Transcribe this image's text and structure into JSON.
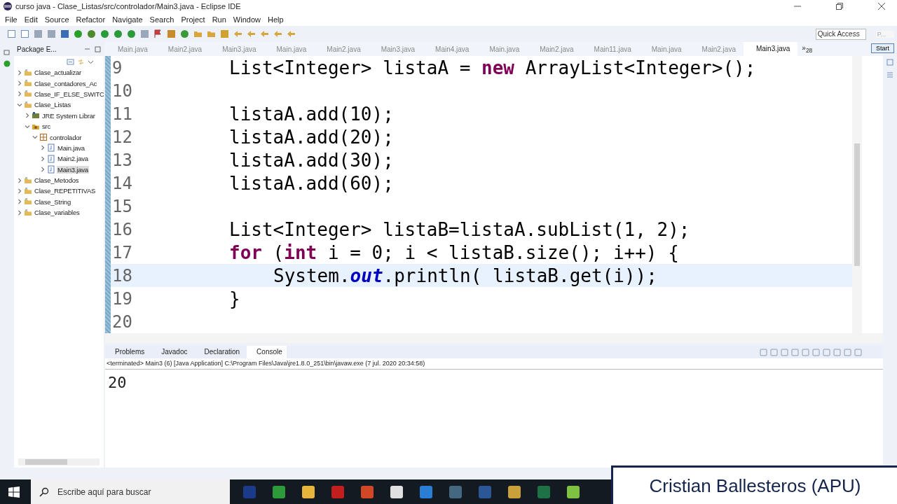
{
  "window": {
    "title": "curso java - Clase_Listas/src/controlador/Main3.java - Eclipse IDE"
  },
  "menu": [
    "File",
    "Edit",
    "Source",
    "Refactor",
    "Navigate",
    "Search",
    "Project",
    "Run",
    "Window",
    "Help"
  ],
  "toolbar": {
    "quick_access": {
      "placeholder": "Quick Access"
    },
    "perspective_label": "P...",
    "start_button": "Start"
  },
  "package_explorer": {
    "title": "Package E...",
    "tree": [
      {
        "label": "Clase_actualizar",
        "kind": "project",
        "expanded": false,
        "selected": false
      },
      {
        "label": "Clase_contadores_Ac",
        "kind": "project",
        "expanded": false,
        "selected": false
      },
      {
        "label": "Clase_IF_ELSE_SWITC",
        "kind": "project",
        "expanded": false,
        "selected": false
      },
      {
        "label": "Clase_Listas",
        "kind": "project",
        "expanded": true,
        "selected": false,
        "children": [
          {
            "label": "JRE System Librar",
            "kind": "library",
            "expanded": false,
            "selected": false
          },
          {
            "label": "src",
            "kind": "source",
            "expanded": true,
            "selected": false,
            "children": [
              {
                "label": "controlador",
                "kind": "package",
                "expanded": true,
                "selected": false,
                "children": [
                  {
                    "label": "Main.java",
                    "kind": "file",
                    "expanded": false,
                    "selected": false
                  },
                  {
                    "label": "Main2.java",
                    "kind": "file",
                    "expanded": false,
                    "selected": false
                  },
                  {
                    "label": "Main3.java",
                    "kind": "file",
                    "expanded": false,
                    "selected": true
                  }
                ]
              }
            ]
          }
        ]
      },
      {
        "label": "Clase_Metodos",
        "kind": "project",
        "expanded": false,
        "selected": false
      },
      {
        "label": "Clase_REPETITIVAS",
        "kind": "project",
        "expanded": false,
        "selected": false
      },
      {
        "label": "Clase_String",
        "kind": "project",
        "expanded": false,
        "selected": false
      },
      {
        "label": "Clase_variables",
        "kind": "project",
        "expanded": false,
        "selected": false
      }
    ]
  },
  "editor": {
    "tabs": [
      {
        "label": "Main.java",
        "selected": false
      },
      {
        "label": "Main2.java",
        "selected": false
      },
      {
        "label": "Main3.java",
        "selected": false
      },
      {
        "label": "Main.java",
        "selected": false
      },
      {
        "label": "Main2.java",
        "selected": false
      },
      {
        "label": "Main3.java",
        "selected": false
      },
      {
        "label": "Main4.java",
        "selected": false
      },
      {
        "label": "Main.java",
        "selected": false
      },
      {
        "label": "Main2.java",
        "selected": false
      },
      {
        "label": "Main11.java",
        "selected": false
      },
      {
        "label": "Main.java",
        "selected": false
      },
      {
        "label": "Main2.java",
        "selected": false
      },
      {
        "label": "Main3.java",
        "selected": true
      }
    ],
    "more_tabs": {
      "label": "»",
      "count": "28"
    },
    "lines": [
      {
        "number": "9",
        "current": false,
        "kind": "statement",
        "tokens": [
          {
            "kind": "plain",
            "text": "List<Integer> listaA = "
          },
          {
            "kind": "keyword",
            "text": "new"
          },
          {
            "kind": "plain",
            "text": " ArrayList<Integer>();"
          }
        ]
      },
      {
        "number": "10",
        "current": false
      },
      {
        "number": "11",
        "current": false,
        "kind": "statement",
        "tokens": [
          {
            "kind": "plain",
            "text": "listaA.add(10);"
          }
        ]
      },
      {
        "number": "12",
        "current": false,
        "kind": "statement",
        "tokens": [
          {
            "kind": "plain",
            "text": "listaA.add(20);"
          }
        ]
      },
      {
        "number": "13",
        "current": false,
        "kind": "statement",
        "tokens": [
          {
            "kind": "plain",
            "text": "listaA.add(30);"
          }
        ]
      },
      {
        "number": "14",
        "current": false,
        "kind": "statement",
        "tokens": [
          {
            "kind": "plain",
            "text": "listaA.add(60);"
          }
        ]
      },
      {
        "number": "15",
        "current": false
      },
      {
        "number": "16",
        "current": false,
        "kind": "statement",
        "tokens": [
          {
            "kind": "plain",
            "text": "List<Integer> listaB=listaA.subList(1, 2);"
          }
        ]
      },
      {
        "number": "17",
        "current": false,
        "kind": "statement",
        "tokens": [
          {
            "kind": "keyword",
            "text": "for"
          },
          {
            "kind": "plain",
            "text": " ("
          },
          {
            "kind": "keyword",
            "text": "int"
          },
          {
            "kind": "plain",
            "text": " i = 0; i < listaB.size(); i++) {"
          }
        ]
      },
      {
        "number": "18",
        "current": true,
        "kind": "nested",
        "tokens": [
          {
            "kind": "plain",
            "text": "System."
          },
          {
            "kind": "field",
            "text": "out"
          },
          {
            "kind": "plain",
            "text": ".println( listaB.get(i));"
          }
        ]
      },
      {
        "number": "19",
        "current": false,
        "kind": "statement",
        "tokens": [
          {
            "kind": "plain",
            "text": "}"
          }
        ]
      },
      {
        "number": "20",
        "current": false
      }
    ]
  },
  "console": {
    "tabs": [
      {
        "label": "Problems",
        "selected": false
      },
      {
        "label": "Javadoc",
        "selected": false
      },
      {
        "label": "Declaration",
        "selected": false
      },
      {
        "label": "Console",
        "selected": true
      }
    ],
    "status": "<terminated> Main3 (6) [Java Application] C:\\Program Files\\Java\\jre1.8.0_251\\bin\\javaw.exe (7 jul. 2020 20:34:58)",
    "output": "20"
  },
  "taskbar": {
    "search": {
      "placeholder": "Escribe aquí para buscar"
    }
  },
  "banner": {
    "text": "Cristian Ballesteros (APU)"
  }
}
